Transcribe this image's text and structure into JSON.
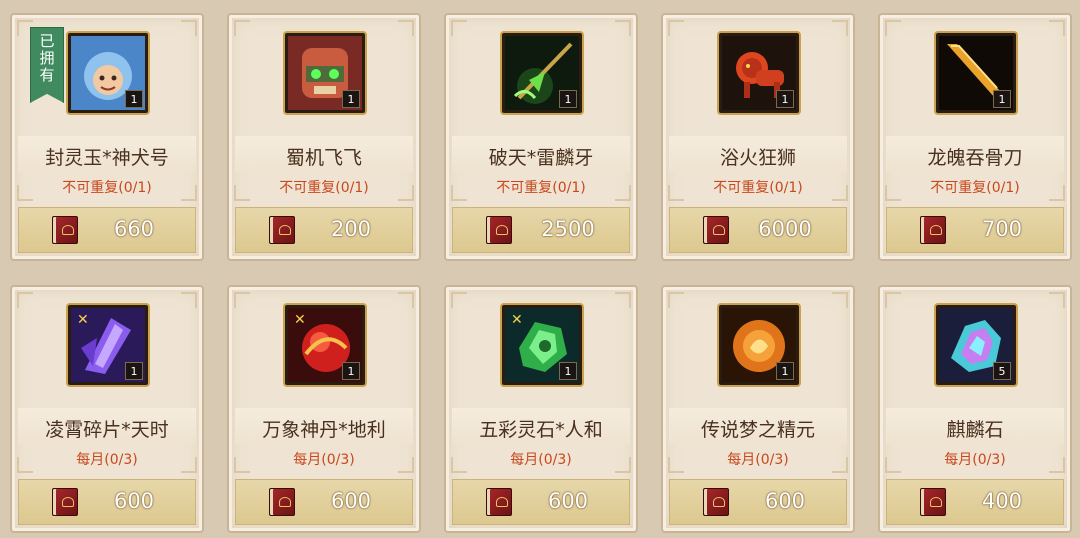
{
  "cards": [
    {
      "name": "封灵玉*神犬号",
      "limit": "不可重复(0/1)",
      "price": "660",
      "qty": "1",
      "icon": "hooded-pet-icon",
      "owned": true
    },
    {
      "name": "蜀机飞飞",
      "limit": "不可重复(0/1)",
      "price": "200",
      "qty": "1",
      "icon": "mech-dog-icon",
      "owned": false
    },
    {
      "name": "破天*雷麟牙",
      "limit": "不可重复(0/1)",
      "price": "2500",
      "qty": "1",
      "icon": "glaive-weapon-icon",
      "owned": false
    },
    {
      "name": "浴火狂狮",
      "limit": "不可重复(0/1)",
      "price": "6000",
      "qty": "1",
      "icon": "fire-lion-icon",
      "owned": false
    },
    {
      "name": "龙魄吞骨刀",
      "limit": "不可重复(0/1)",
      "price": "700",
      "qty": "1",
      "icon": "golden-blade-icon",
      "owned": false
    },
    {
      "name": "凌霄碎片*天时",
      "limit": "每月(0/3)",
      "price": "600",
      "qty": "1",
      "icon": "purple-crystal-icon",
      "owned": false
    },
    {
      "name": "万象神丹*地利",
      "limit": "每月(0/3)",
      "price": "600",
      "qty": "1",
      "icon": "red-orb-icon",
      "owned": false
    },
    {
      "name": "五彩灵石*人和",
      "limit": "每月(0/3)",
      "price": "600",
      "qty": "1",
      "icon": "green-gem-icon",
      "owned": false
    },
    {
      "name": "传说梦之精元",
      "limit": "每月(0/3)",
      "price": "600",
      "qty": "1",
      "icon": "golden-essence-icon",
      "owned": false
    },
    {
      "name": "麒麟石",
      "limit": "每月(0/3)",
      "price": "400",
      "qty": "5",
      "icon": "rainbow-crystal-icon",
      "owned": false
    }
  ],
  "owned_badge": [
    "已",
    "拥",
    "有"
  ],
  "currency_icon": "book-currency-icon"
}
